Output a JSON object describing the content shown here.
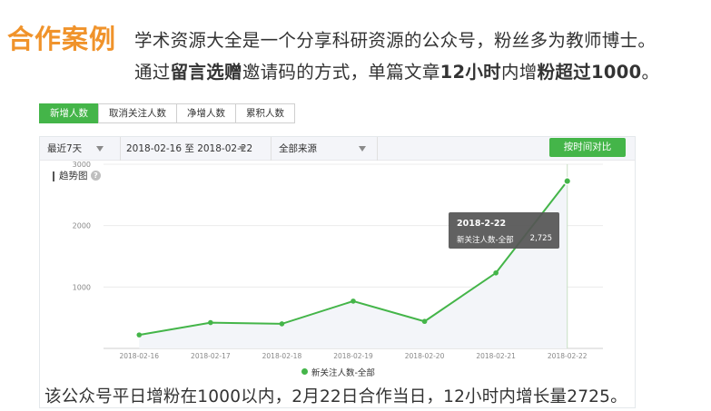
{
  "header": {
    "case_title": "合作案例",
    "line1": "学术资源大全是一个分享科研资源的公众号，粉丝多为教师博士。",
    "line2_pre": "通过",
    "line2_b1": "留言选赠",
    "line2_mid": "邀请码的方式，单篇文章",
    "line2_b2": "12小时",
    "line2_mid2": "内增",
    "line2_b3": "粉超过",
    "line2_b4": "1000",
    "line2_end": "。"
  },
  "tabs": [
    {
      "label": "新增人数",
      "active": true
    },
    {
      "label": "取消关注人数",
      "active": false
    },
    {
      "label": "净增人数",
      "active": false
    },
    {
      "label": "累积人数",
      "active": false
    }
  ],
  "filters": {
    "range": "最近7天",
    "dates": "2018-02-16 至 2018-02-22",
    "source": "全部来源",
    "compare_button": "按时间对比"
  },
  "trend_label": "趋势图",
  "help_glyph": "?",
  "tooltip": {
    "date": "2018-2-22",
    "series": "新关注人数-全部",
    "value": "2,725"
  },
  "colors": {
    "accent": "#44b549",
    "title_orange": "#f0932b"
  },
  "chart_data": {
    "type": "area",
    "x": [
      "2018-02-16",
      "2018-02-17",
      "2018-02-18",
      "2018-02-19",
      "2018-02-20",
      "2018-02-21",
      "2018-02-22"
    ],
    "series": [
      {
        "name": "新关注人数-全部",
        "values": [
          220,
          420,
          400,
          770,
          440,
          1230,
          2725
        ]
      }
    ],
    "ylim": [
      0,
      3000
    ],
    "yticks": [
      1000,
      2000,
      3000
    ],
    "grid": true,
    "legend_position": "bottom"
  },
  "caption": "该公众号平日增粉在1000以内，2月22日合作当日，12小时内增长量2725。"
}
